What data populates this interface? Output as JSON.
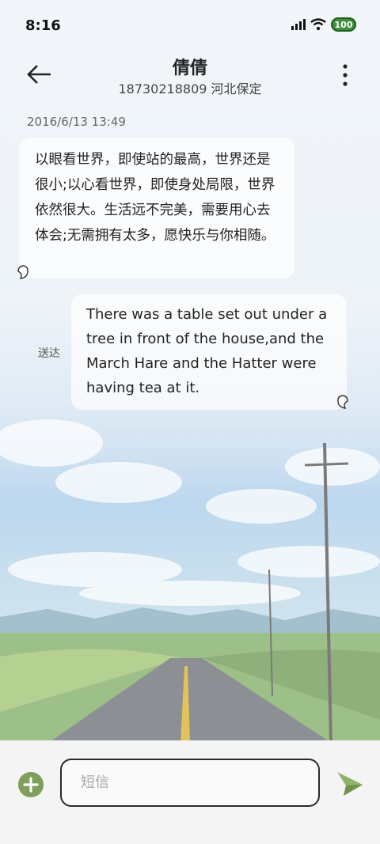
{
  "status_bar": {
    "time": "8:16",
    "battery": "100"
  },
  "header": {
    "title": "倩倩",
    "subtitle": "18730218809 河北保定"
  },
  "conversation": {
    "timestamp": "2016/6/13 13:49",
    "messages": [
      {
        "direction": "incoming",
        "text": "以眼看世界，即使站的最高，世界还是很小;以心看世界，即使身处局限，世界依然很大。生活远不完美，需要用心去体会;无需拥有太多，愿快乐与你相随。"
      },
      {
        "direction": "outgoing",
        "status": "送达",
        "text": "There was a table set out under a tree in front of the house,and the March Hare and the Hatter were having tea at it."
      }
    ]
  },
  "composer": {
    "placeholder": "短信"
  },
  "colors": {
    "accent": "#7ea05c",
    "send": "#8fb26a",
    "battery": "#3f8f3d"
  },
  "icons": {
    "back": "arrow-left-icon",
    "more": "more-vertical-icon",
    "add": "plus-circle-icon",
    "send": "send-plane-icon"
  }
}
